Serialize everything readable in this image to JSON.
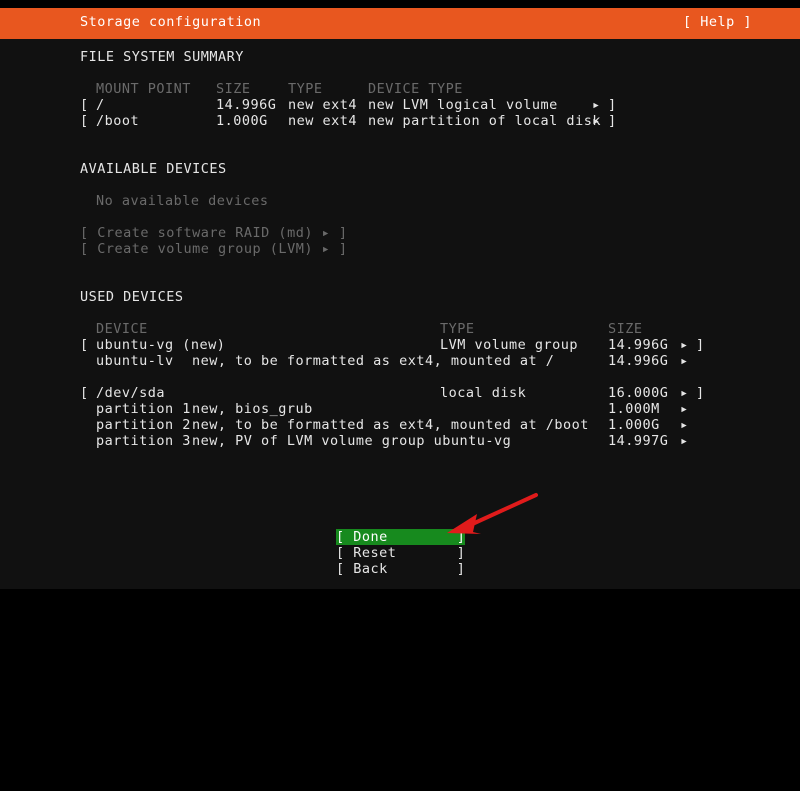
{
  "window": {
    "title": "Storage configuration",
    "help_label": "[ Help ]"
  },
  "colors": {
    "header_bg": "#e8571f",
    "terminal_bg": "#111111",
    "outer_bg": "#000000",
    "text": "#e6e6e6",
    "dim_text": "#6a6a6a",
    "selected_bg": "#178a1e",
    "annotation": "#e01b1b"
  },
  "filesystem_summary": {
    "heading": "FILE SYSTEM SUMMARY",
    "columns": {
      "mount_point": "MOUNT POINT",
      "size": "SIZE",
      "type": "TYPE",
      "device_type": "DEVICE TYPE"
    },
    "rows": [
      {
        "open_bracket": "[",
        "mount_point": "/",
        "size": "14.996G",
        "type": "new ext4",
        "device_type": "new LVM logical volume",
        "marker": "▸",
        "close_bracket": "]"
      },
      {
        "open_bracket": "[",
        "mount_point": "/boot",
        "size": "1.000G",
        "type": "new ext4",
        "device_type": "new partition of local disk",
        "marker": "▸",
        "close_bracket": "]"
      }
    ]
  },
  "available_devices": {
    "heading": "AVAILABLE DEVICES",
    "empty_message": "No available devices",
    "actions": [
      {
        "label": "[ Create software RAID (md) ▸ ]"
      },
      {
        "label": "[ Create volume group (LVM) ▸ ]"
      }
    ]
  },
  "used_devices": {
    "heading": "USED DEVICES",
    "columns": {
      "device": "DEVICE",
      "type": "TYPE",
      "size": "SIZE"
    },
    "groups": [
      {
        "header": {
          "open_bracket": "[",
          "device": "ubuntu-vg (new)",
          "type": "LVM volume group",
          "size": "14.996G",
          "marker": "▸",
          "close_bracket": "]"
        },
        "children": [
          {
            "name": "ubuntu-lv",
            "detail": "new, to be formatted as ext4, mounted at /",
            "size": "14.996G",
            "marker": "▸"
          }
        ]
      },
      {
        "header": {
          "open_bracket": "[",
          "device": "/dev/sda",
          "type": "local disk",
          "size": "16.000G",
          "marker": "▸",
          "close_bracket": "]"
        },
        "children": [
          {
            "name": "partition 1",
            "detail": "new, bios_grub",
            "size": "1.000M",
            "marker": "▸"
          },
          {
            "name": "partition 2",
            "detail": "new, to be formatted as ext4, mounted at /boot",
            "size": "1.000G",
            "marker": "▸"
          },
          {
            "name": "partition 3",
            "detail": "new, PV of LVM volume group ubuntu-vg",
            "size": "14.997G",
            "marker": "▸"
          }
        ]
      }
    ]
  },
  "buttons": [
    {
      "label": "[ Done        ]",
      "selected": true
    },
    {
      "label": "[ Reset       ]",
      "selected": false
    },
    {
      "label": "[ Back        ]",
      "selected": false
    }
  ]
}
